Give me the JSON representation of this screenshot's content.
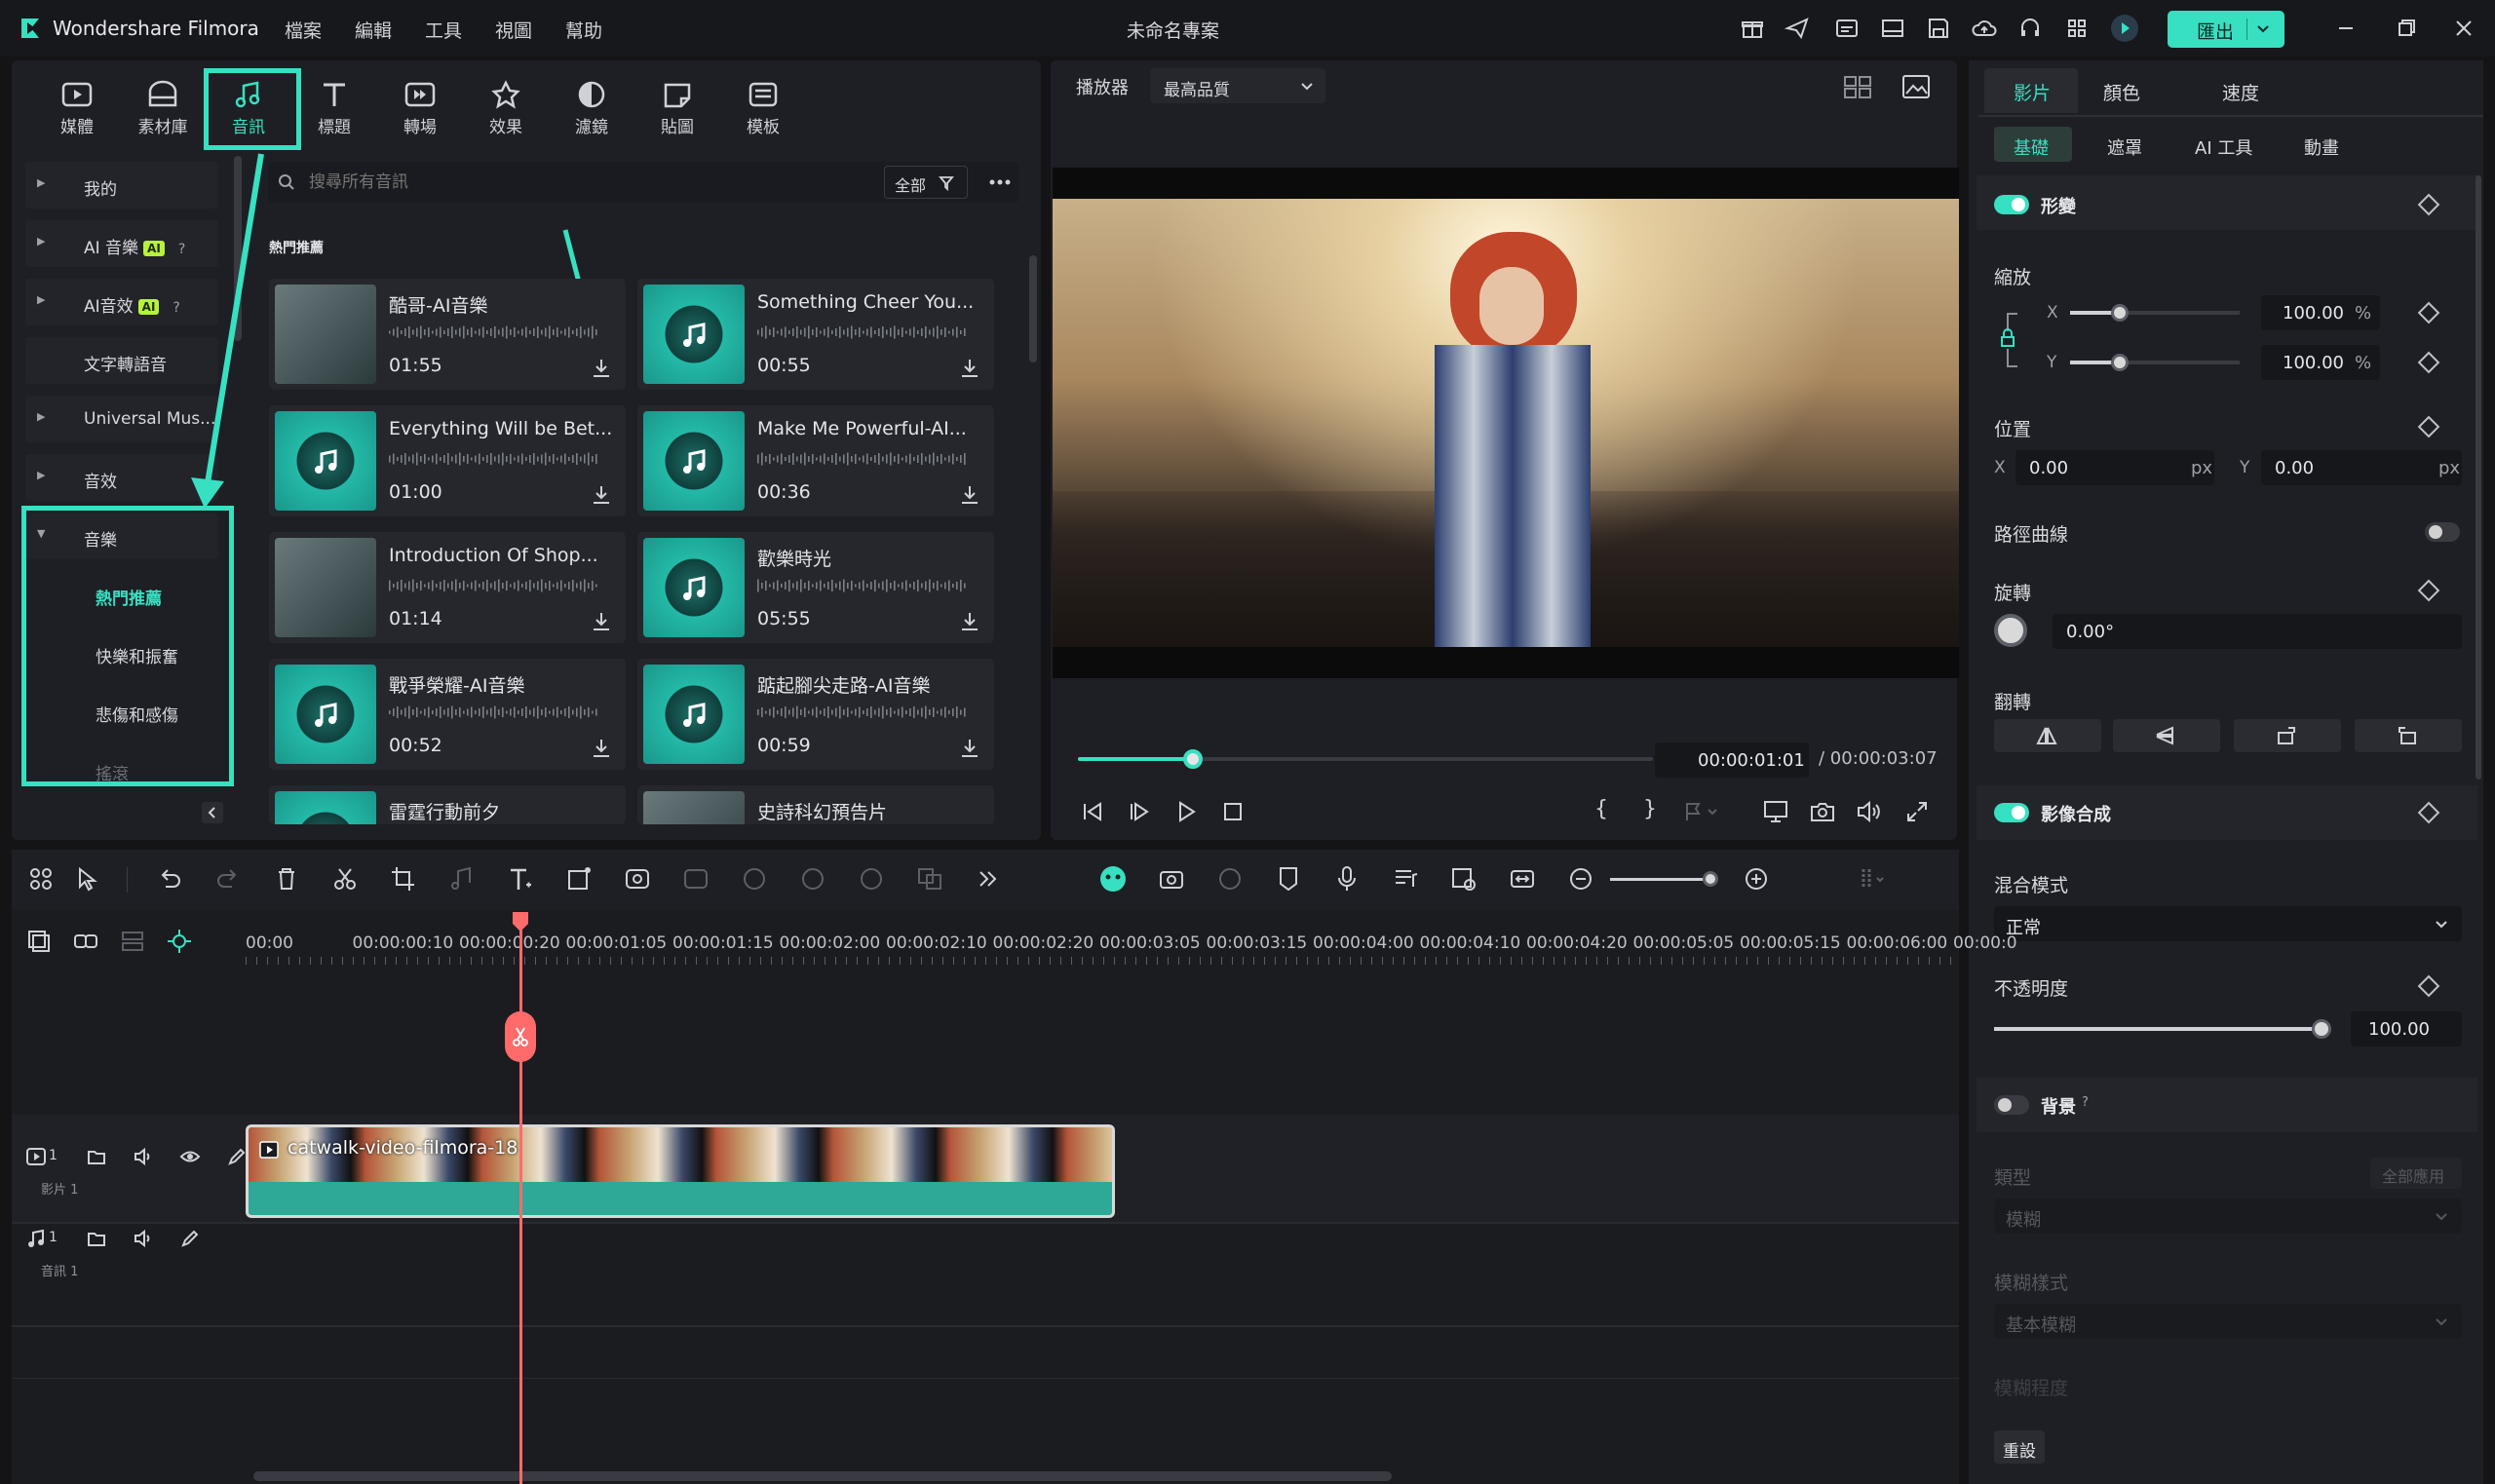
{
  "app": {
    "name": "Wondershare Filmora",
    "project_title": "未命名專案",
    "menu": [
      "檔案",
      "編輯",
      "工具",
      "視圖",
      "幫助"
    ],
    "export_label": "匯出"
  },
  "media_tabs": [
    {
      "label": "媒體",
      "icon": "media-icon"
    },
    {
      "label": "素材庫",
      "icon": "stock-icon"
    },
    {
      "label": "音訊",
      "icon": "music-note-icon",
      "selected": true
    },
    {
      "label": "標題",
      "icon": "title-icon"
    },
    {
      "label": "轉場",
      "icon": "transition-icon"
    },
    {
      "label": "效果",
      "icon": "effects-icon"
    },
    {
      "label": "濾鏡",
      "icon": "filter-icon"
    },
    {
      "label": "貼圖",
      "icon": "sticker-icon"
    },
    {
      "label": "模板",
      "icon": "template-icon"
    }
  ],
  "library": {
    "items": [
      {
        "label": "我的"
      },
      {
        "label": "AI 音樂",
        "badge": "AI"
      },
      {
        "label": "AI音效",
        "badge": "AI"
      },
      {
        "label": "文字轉語音"
      },
      {
        "label": "Universal Mus..."
      },
      {
        "label": "音效"
      },
      {
        "label": "音樂"
      }
    ],
    "sub_items": [
      {
        "label": "熱門推薦",
        "active": true
      },
      {
        "label": "快樂和振奮"
      },
      {
        "label": "悲傷和感傷"
      },
      {
        "label": "搖滾"
      }
    ]
  },
  "search": {
    "placeholder": "搜尋所有音訊",
    "filter_label": "全部"
  },
  "grid": {
    "heading": "熱門推薦",
    "tracks": [
      {
        "name": "酷哥-AI音樂",
        "duration": "01:55",
        "thumb": "video"
      },
      {
        "name": "Something Cheer You...",
        "duration": "00:55",
        "thumb": "music"
      },
      {
        "name": "Everything Will be Bet...",
        "duration": "01:00",
        "thumb": "music"
      },
      {
        "name": "Make Me Powerful-AI...",
        "duration": "00:36",
        "thumb": "music"
      },
      {
        "name": "Introduction Of Shop...",
        "duration": "01:14",
        "thumb": "video"
      },
      {
        "name": "歡樂時光",
        "duration": "05:55",
        "thumb": "music"
      },
      {
        "name": "戰爭榮耀-AI音樂",
        "duration": "00:52",
        "thumb": "music"
      },
      {
        "name": "踮起腳尖走路-AI音樂",
        "duration": "00:59",
        "thumb": "music"
      },
      {
        "name": "雷霆行動前夕",
        "duration": "",
        "thumb": "music"
      },
      {
        "name": "史詩科幻預告片",
        "duration": "",
        "thumb": "video"
      }
    ]
  },
  "player": {
    "label": "播放器",
    "quality": "最高品質",
    "current_time": "00:00:01:01",
    "total_time": "/ 00:00:03:07",
    "progress": 0.2
  },
  "props": {
    "tabs": [
      "影片",
      "顏色",
      "速度"
    ],
    "subtabs": [
      "基礎",
      "遮罩",
      "AI 工具",
      "動畫"
    ],
    "transform": {
      "title": "形變",
      "scale_label": "縮放",
      "x_label": "X",
      "y_label": "Y",
      "scale_x": "100.00",
      "scale_y": "100.00",
      "percent": "%",
      "position_label": "位置",
      "pos_x": "0.00",
      "pos_y": "0.00",
      "px": "px",
      "path_curve_label": "路徑曲線",
      "rotate_label": "旋轉",
      "rotate_value": "0.00°",
      "flip_label": "翻轉"
    },
    "compositing": {
      "title": "影像合成",
      "blend_label": "混合模式",
      "blend_value": "正常",
      "opacity_label": "不透明度",
      "opacity_value": "100.00"
    },
    "background": {
      "title": "背景",
      "type_label": "類型",
      "apply_all": "全部應用",
      "type_value": "模糊",
      "blur_style_label": "模糊樣式",
      "blur_style_value": "基本模糊",
      "blur_level_label": "模糊程度"
    },
    "reset_label": "重設"
  },
  "timeline": {
    "ruler": [
      "00:00",
      "00:00:00:10",
      "00:00:00:20",
      "00:00:01:05",
      "00:00:01:15",
      "00:00:02:00",
      "00:00:02:10",
      "00:00:02:20",
      "00:00:03:05",
      "00:00:03:15",
      "00:00:04:00",
      "00:00:04:10",
      "00:00:04:20",
      "00:00:05:05",
      "00:00:05:15",
      "00:00:06:00",
      "00:00:0"
    ],
    "clip_name": "catwalk-video-filmora-18",
    "video_track_label": "影片 1",
    "audio_track_label": "音訊 1",
    "video_track_num": "1",
    "audio_track_num": "1"
  },
  "colors": {
    "accent": "#37e0c1",
    "playhead": "#ff6b6b",
    "panel": "#1e1f24",
    "background": "#141417"
  }
}
